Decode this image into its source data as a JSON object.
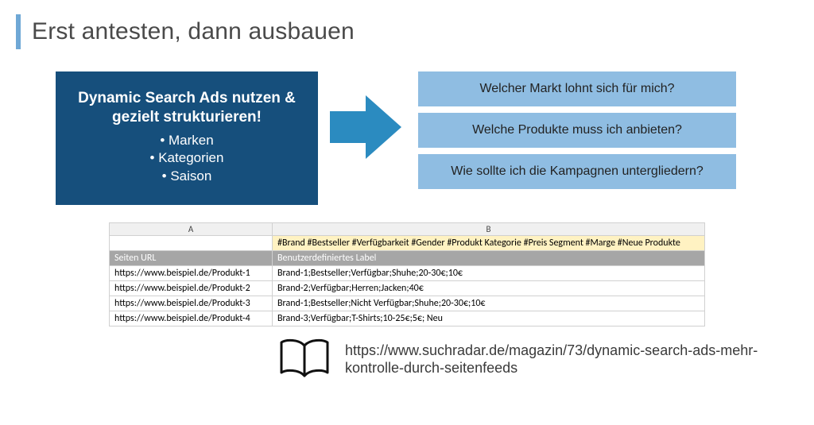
{
  "title": "Erst antesten, dann ausbauen",
  "dsa": {
    "heading": "Dynamic Search Ads nutzen & gezielt strukturieren!",
    "bullets": [
      "Marken",
      "Kategorien",
      "Saison"
    ]
  },
  "questions": [
    "Welcher Markt lohnt sich für mich?",
    "Welche Produkte muss ich anbieten?",
    "Wie sollte ich die Kampagnen untergliedern?"
  ],
  "sheet": {
    "col_a": "A",
    "col_b": "B",
    "tagline": "#Brand #Bestseller #Verfügbarkeit #Gender #Produkt Kategorie #Preis Segment #Marge #Neue Produkte",
    "header_a": "Seiten URL",
    "header_b": "Benutzerdefiniertes Label",
    "rows": [
      {
        "url": "https://www.beispiel.de/Produkt-1",
        "label": "Brand-1;Bestseller;Verfügbar;Shuhe;20-30€;10€"
      },
      {
        "url": "https://www.beispiel.de/Produkt-2",
        "label": "Brand-2;Verfügbar;Herren;Jacken;40€"
      },
      {
        "url": "https://www.beispiel.de/Produkt-3",
        "label": "Brand-1;Bestseller;Nicht Verfügbar;Shuhe;20-30€;10€"
      },
      {
        "url": "https://www.beispiel.de/Produkt-4",
        "label": "Brand-3;Verfügbar;T-Shirts;10-25€;5€; Neu"
      }
    ]
  },
  "footer_link": "https://www.suchradar.de/magazin/73/dynamic-search-ads-mehr-kontrolle-durch-seitenfeeds"
}
